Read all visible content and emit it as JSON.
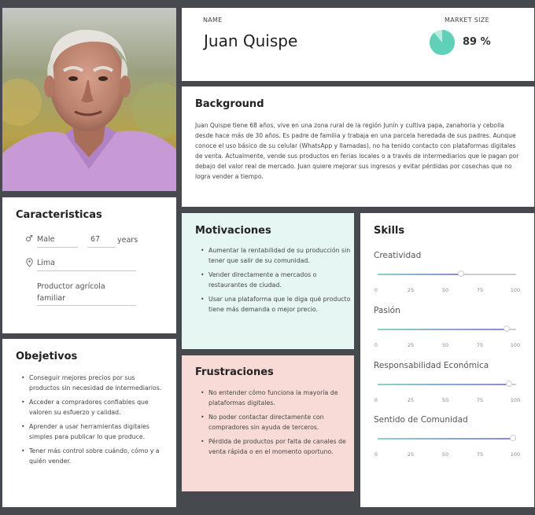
{
  "header": {
    "name_label": "NAME",
    "name": "Juan Quispe",
    "market_label": "MARKET SIZE",
    "market_value": "89 %",
    "market_fraction": 0.89
  },
  "background": {
    "title": "Background",
    "text": "Juan Quispe tiene 68 años, vive en una zona rural de la región Junín y cultiva papa, zanahoria y cebolla desde hace más de 30 años. Es padre de familia y trabaja en una parcela heredada de sus padres. Aunque conoce el uso básico de su celular (WhatsApp y llamadas), no ha tenido contacto con plataformas digitales de venta. Actualmente, vende sus productos en ferias locales o a través de intermediarios que le pagan por debajo del valor real de mercado. Juan quiere mejorar sus ingresos y evitar pérdidas por cosechas que no logra vender a tiempo."
  },
  "caracteristicas": {
    "title": "Caracteristicas",
    "gender": "Male",
    "age": "67",
    "age_unit": "years",
    "location": "Lima",
    "occupation": "Productor agrícola familiar"
  },
  "objetivos": {
    "title": "Obejetivos",
    "items": [
      "Conseguir mejores precios por sus productos sin necesidad de intermediarios.",
      "Acceder a compradores confiables que valoren su esfuerzo y calidad.",
      "Aprender a usar herramientas digitales simples para publicar lo que produce.",
      "Tener más control sobre cuándo, cómo y a quién vender."
    ]
  },
  "motivaciones": {
    "title": "Motivaciones",
    "items": [
      "Aumentar la rentabilidad de su producción sin tener que salir de su comunidad.",
      "Vender directamente a mercados o restaurantes de ciudad.",
      "Usar una plataforma que le diga qué producto tiene más demanda o mejor precio."
    ]
  },
  "frustraciones": {
    "title": "Frustraciones",
    "items": [
      "No entender cómo funciona la mayoría de plataformas digitales.",
      "No poder contactar directamente con compradores sin ayuda de terceros.",
      "Pérdida de productos por falta de canales de venta rápida o en el momento oportuno."
    ]
  },
  "skills": {
    "title": "Skills",
    "ticks": [
      "0",
      "25",
      "50",
      "75",
      "100"
    ],
    "items": [
      {
        "name": "Creatividad",
        "value": 60
      },
      {
        "name": "Pasión",
        "value": 93
      },
      {
        "name": "Responsabilidad Económica",
        "value": 95
      },
      {
        "name": "Sentido de Comunidad",
        "value": 98
      }
    ]
  },
  "colors": {
    "accent": "#5fd1b8",
    "motivaciones_bg": "#e6f7f3",
    "frustraciones_bg": "#f8dbd6",
    "page_bg": "#464a4f"
  }
}
